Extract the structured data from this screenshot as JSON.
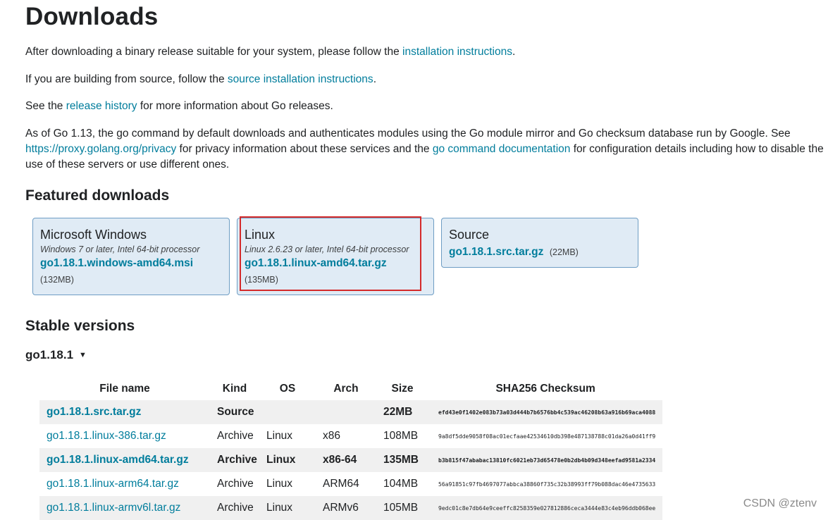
{
  "title": "Downloads",
  "intro": {
    "p1_before": "After downloading a binary release suitable for your system, please follow the ",
    "p1_link": "installation instructions",
    "p1_after": ".",
    "p2_before": "If you are building from source, follow the ",
    "p2_link": "source installation instructions",
    "p2_after": ".",
    "p3_before": "See the ",
    "p3_link": "release history",
    "p3_after": " for more information about Go releases.",
    "p4_before": "As of Go 1.13, the go command by default downloads and authenticates modules using the Go module mirror and Go checksum database run by Google. See ",
    "p4_link1": "https://proxy.golang.org/privacy",
    "p4_mid": " for privacy information about these services and the ",
    "p4_link2": "go command documentation",
    "p4_after": " for configuration details including how to disable the use of these servers or use different ones."
  },
  "featured": {
    "heading": "Featured downloads",
    "cards": [
      {
        "os": "Microsoft Windows",
        "desc": "Windows 7 or later, Intel 64-bit processor",
        "file": "go1.18.1.windows-amd64.msi",
        "size": "(132MB)"
      },
      {
        "os": "Linux",
        "desc": "Linux 2.6.23 or later, Intel 64-bit processor",
        "file": "go1.18.1.linux-amd64.tar.gz",
        "size": "(135MB)"
      },
      {
        "os": "Source",
        "desc": "",
        "file": "go1.18.1.src.tar.gz",
        "size": "(22MB)"
      }
    ]
  },
  "stable": {
    "heading": "Stable versions",
    "version": "go1.18.1",
    "caret": "▼",
    "columns": [
      "File name",
      "Kind",
      "OS",
      "Arch",
      "Size",
      "SHA256 Checksum"
    ],
    "rows": [
      {
        "file": "go1.18.1.src.tar.gz",
        "kind": "Source",
        "os": "",
        "arch": "",
        "size": "22MB",
        "sha": "efd43e0f1402e083b73a03d444b7b6576bb4c539ac46208b63a916b69aca4088"
      },
      {
        "file": "go1.18.1.linux-386.tar.gz",
        "kind": "Archive",
        "os": "Linux",
        "arch": "x86",
        "size": "108MB",
        "sha": "9a8df5dde9058f08ac01ecfaae42534610db398e487138788c01da26a0d41ff9"
      },
      {
        "file": "go1.18.1.linux-amd64.tar.gz",
        "kind": "Archive",
        "os": "Linux",
        "arch": "x86-64",
        "size": "135MB",
        "sha": "b3b815f47ababac13810fc6021eb73d65478e0b2db4b09d348eefad9581a2334"
      },
      {
        "file": "go1.18.1.linux-arm64.tar.gz",
        "kind": "Archive",
        "os": "Linux",
        "arch": "ARM64",
        "size": "104MB",
        "sha": "56a91851c97fb4697077abbca38860f735c32b38993ff79b088dac46e4735633"
      },
      {
        "file": "go1.18.1.linux-armv6l.tar.gz",
        "kind": "Archive",
        "os": "Linux",
        "arch": "ARMv6",
        "size": "105MB",
        "sha": "9edc01c8e7db64e9ceeffc8258359e027812886ceca3444e83c4eb96ddb068ee"
      }
    ]
  },
  "watermark": "CSDN @ztenv"
}
